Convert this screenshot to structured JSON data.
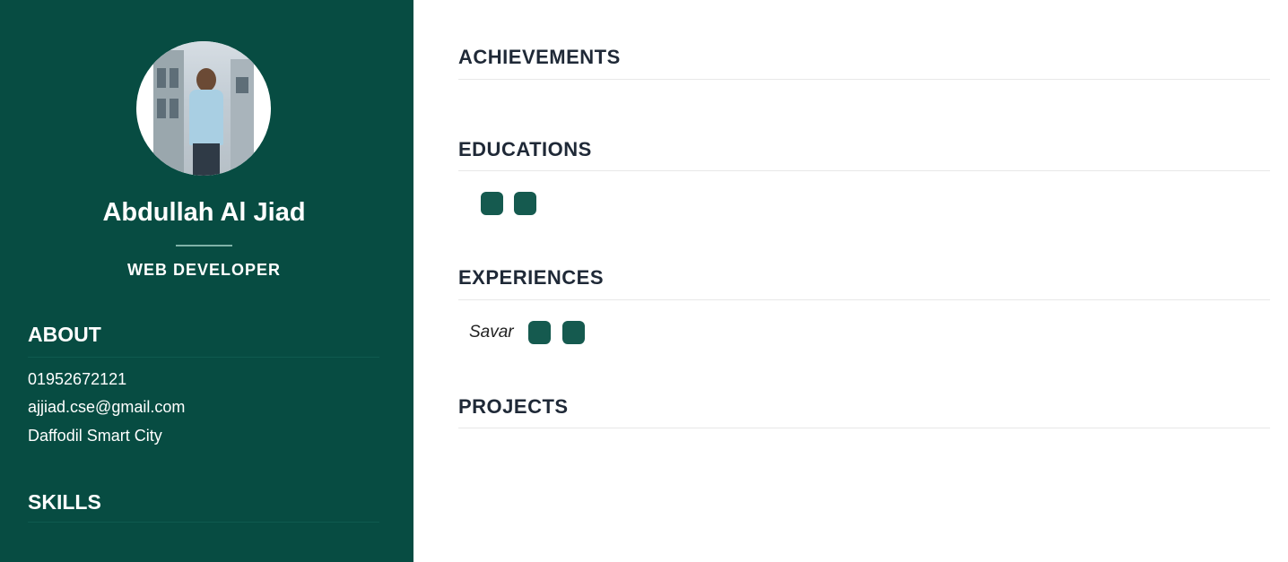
{
  "profile": {
    "name": "Abdullah Al Jiad",
    "role": "WEB DEVELOPER",
    "photo_alt": "profile-photo"
  },
  "about": {
    "heading": "ABOUT",
    "phone": "01952672121",
    "email": "ajjiad.cse@gmail.com",
    "address": "Daffodil Smart City"
  },
  "skills": {
    "heading": "SKILLS"
  },
  "sections": {
    "achievements": "ACHIEVEMENTS",
    "educations": "EDUCATIONS",
    "experiences": "EXPERIENCES",
    "projects": "PROJECTS"
  },
  "experience_item": {
    "location": "Savar"
  },
  "colors": {
    "sidebar_bg": "#074c42",
    "chip": "#155a4f",
    "heading_dark": "#1f2937"
  }
}
